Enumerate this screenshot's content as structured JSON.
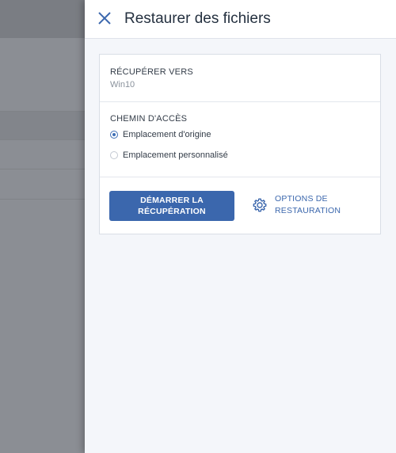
{
  "panel": {
    "title": "Restaurer des fichiers"
  },
  "recover_to": {
    "label": "RÉCUPÉRER VERS",
    "value": "Win10"
  },
  "path": {
    "label": "CHEMIN D'ACCÈS",
    "options": [
      {
        "label": "Emplacement d'origine",
        "selected": true
      },
      {
        "label": "Emplacement personnalisé",
        "selected": false
      }
    ]
  },
  "actions": {
    "start_line1": "DÉMARRER LA",
    "start_line2": "RÉCUPÉRATION",
    "options_line1": "OPTIONS DE",
    "options_line2": "RESTAURATION"
  },
  "colors": {
    "accent": "#3b67ad",
    "overlay": "#8b8e94"
  },
  "icons": {
    "close": "close-icon",
    "settings": "gear-icon"
  }
}
